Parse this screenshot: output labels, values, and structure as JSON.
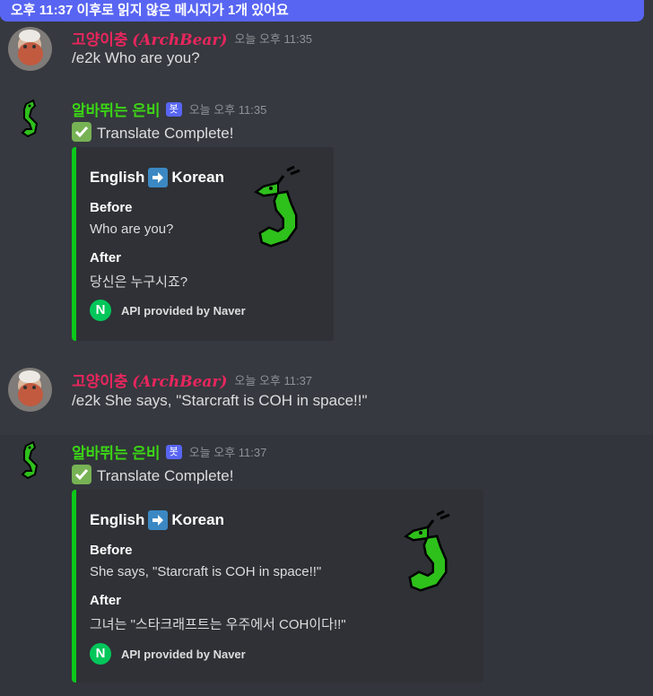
{
  "banner": {
    "text": "오후 11:37 이후로 읽지 않은 메시지가 1개 있어요"
  },
  "messages": [
    {
      "user_plain": "고양이충 ",
      "user_fancy": "(ArchBear)",
      "timestamp": "오늘 오후 11:35",
      "content": "/e2k Who are you?"
    },
    {
      "user": "알바뛰는 은비",
      "bot_badge": "봇",
      "timestamp": "오늘 오후 11:35",
      "content": "Translate Complete!",
      "embed": {
        "title_from": "English",
        "title_to": "Korean",
        "before_label": "Before",
        "before_value": "Who are you?",
        "after_label": "After",
        "after_value": "당신은 누구시죠?",
        "footer": "API provided by Naver",
        "footer_logo": "N"
      }
    },
    {
      "user_plain": "고양이충 ",
      "user_fancy": "(ArchBear)",
      "timestamp": "오늘 오후 11:37",
      "content": "/e2k She says, \"Starcraft is COH in space!!\""
    },
    {
      "user": "알바뛰는 은비",
      "bot_badge": "봇",
      "timestamp": "오늘 오후 11:37",
      "content": "Translate Complete!",
      "embed": {
        "title_from": "English",
        "title_to": "Korean",
        "before_label": "Before",
        "before_value": "She says, \"Starcraft is COH in space!!\"",
        "after_label": "After",
        "after_value": "그녀는 \"스타크래프트는 우주에서 COH이다!!\"",
        "footer": "API provided by Naver",
        "footer_logo": "N"
      }
    }
  ],
  "colors": {
    "bot_name": "#3bd515",
    "user_name": "#e8265d",
    "embed_bar": "#0cc81a",
    "banner": "#5865f2"
  },
  "icons": {
    "check": "white-check-mark-icon",
    "arrow": "arrow-right-icon",
    "naver": "naver-logo-icon"
  }
}
